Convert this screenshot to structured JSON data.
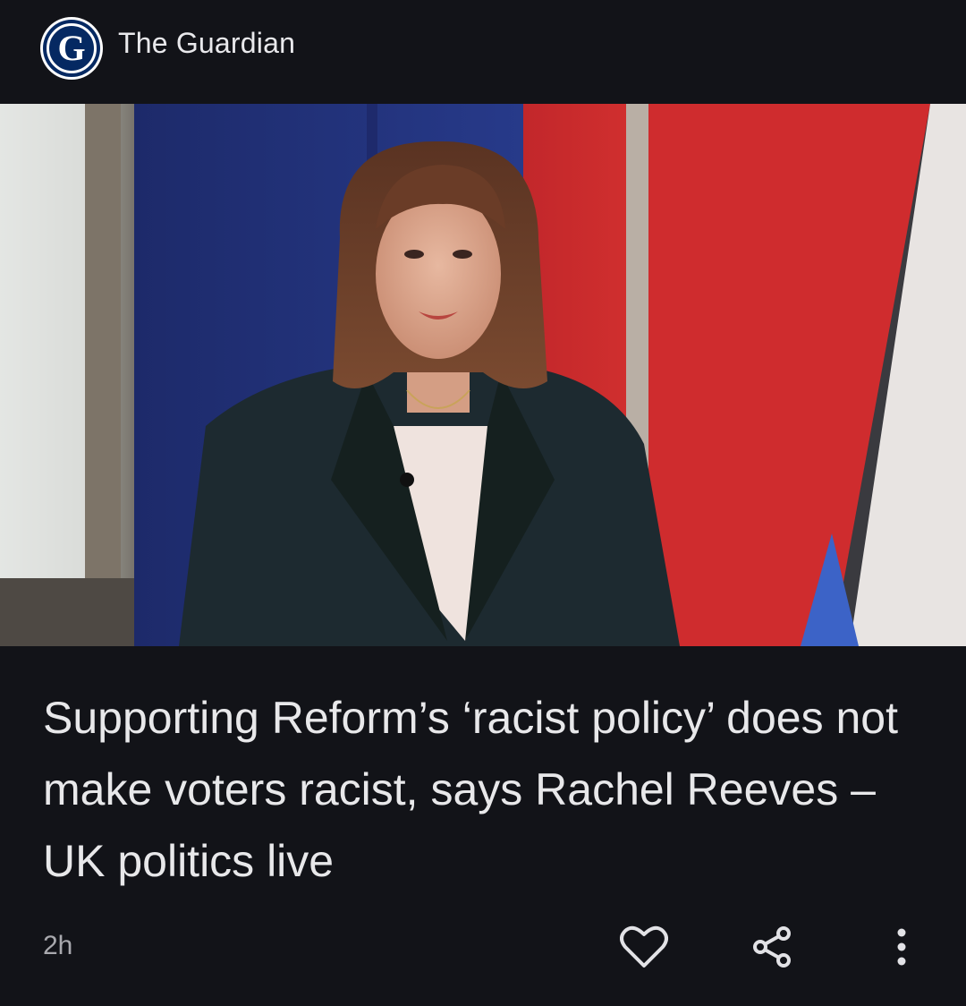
{
  "publisher": {
    "name": "The Guardian",
    "logo_letter": "G",
    "brand_color": "#052962"
  },
  "article": {
    "headline": "Supporting Reform’s ‘racist policy’ does not make voters racist, says Rachel Reeves – UK politics live",
    "age": "2h"
  },
  "actions": {
    "like_icon": "heart-icon",
    "share_icon": "share-icon",
    "more_icon": "more-vert-icon"
  },
  "colors": {
    "background": "#121318",
    "text": "#e8e8ea",
    "muted": "#a9a9ae"
  }
}
